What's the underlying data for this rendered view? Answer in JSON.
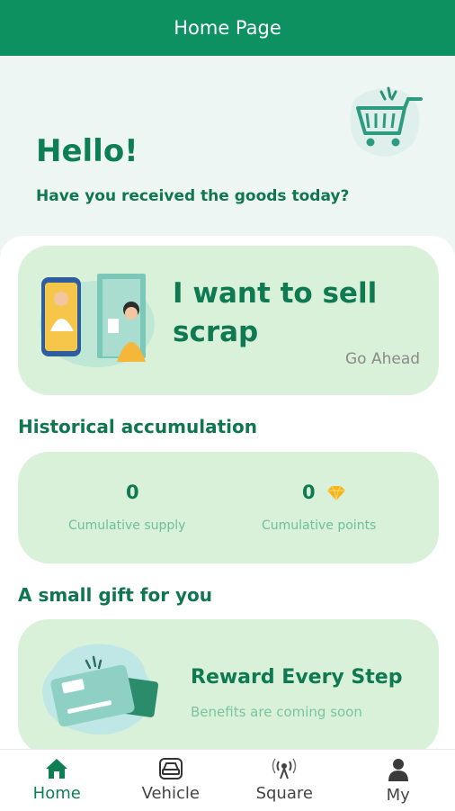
{
  "header": {
    "title": "Home Page"
  },
  "hero": {
    "greeting": "Hello!",
    "subtitle": "Have you received the goods today?"
  },
  "sell_card": {
    "title": "I want to sell scrap",
    "action": "Go Ahead"
  },
  "history": {
    "title": "Historical accumulation",
    "supply": {
      "value": "0",
      "label": "Cumulative supply"
    },
    "points": {
      "value": "0",
      "label": "Cumulative points"
    }
  },
  "gift": {
    "title": "A small gift for you",
    "card_title": "Reward Every Step",
    "card_subtitle": "Benefits are coming soon"
  },
  "tabs": [
    {
      "label": "Home",
      "icon": "home-icon",
      "active": true
    },
    {
      "label": "Vehicle",
      "icon": "vehicle-icon",
      "active": false
    },
    {
      "label": "Square",
      "icon": "broadcast-icon",
      "active": false
    },
    {
      "label": "My",
      "icon": "user-icon",
      "active": false
    }
  ],
  "colors": {
    "brand": "#0e9161",
    "accent_text": "#0f7a52",
    "card_bg": "#d8f1d8",
    "diamond": "#f5b41a"
  }
}
